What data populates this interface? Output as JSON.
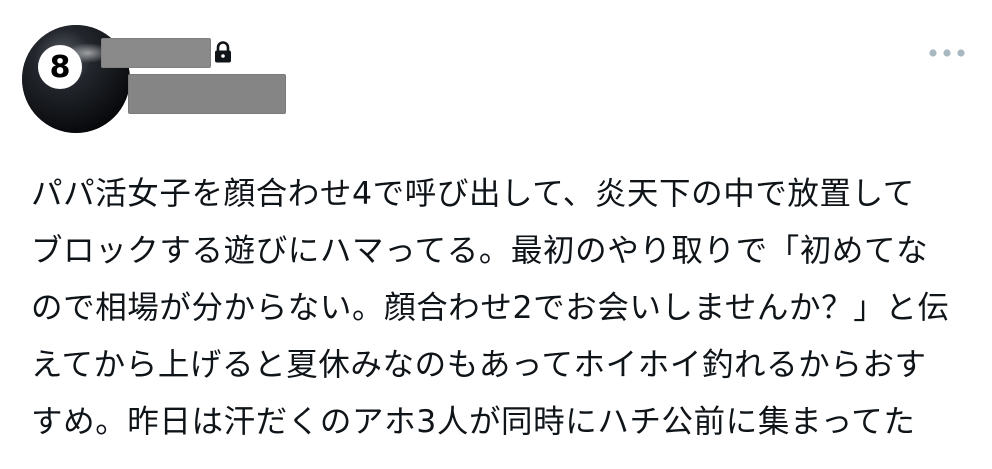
{
  "tweet": {
    "author_name": "",
    "author_handle": "",
    "is_protected": true,
    "avatar_label": "8",
    "lock_icon": "lock-icon",
    "more_icon": "more-options-icon",
    "text": "パパ活女子を顔合わせ4で呼び出して、炎天下の中で放置して\nブロックする遊びにハマってる。最初のやり取りで「初めてな\nので相場が分からない。顔合わせ2でお会いしませんか？」と伝\nえてから上げると夏休みなのもあってホイホイ釣れるからおす\nすめ。昨日は汗だくのアホ3人が同時にハチ公前に集まってた"
  },
  "colors": {
    "text": "#0f1419",
    "redaction": "#8a8a8a",
    "more_dots": "#aab8c2",
    "avatar_ball": "#111418"
  }
}
